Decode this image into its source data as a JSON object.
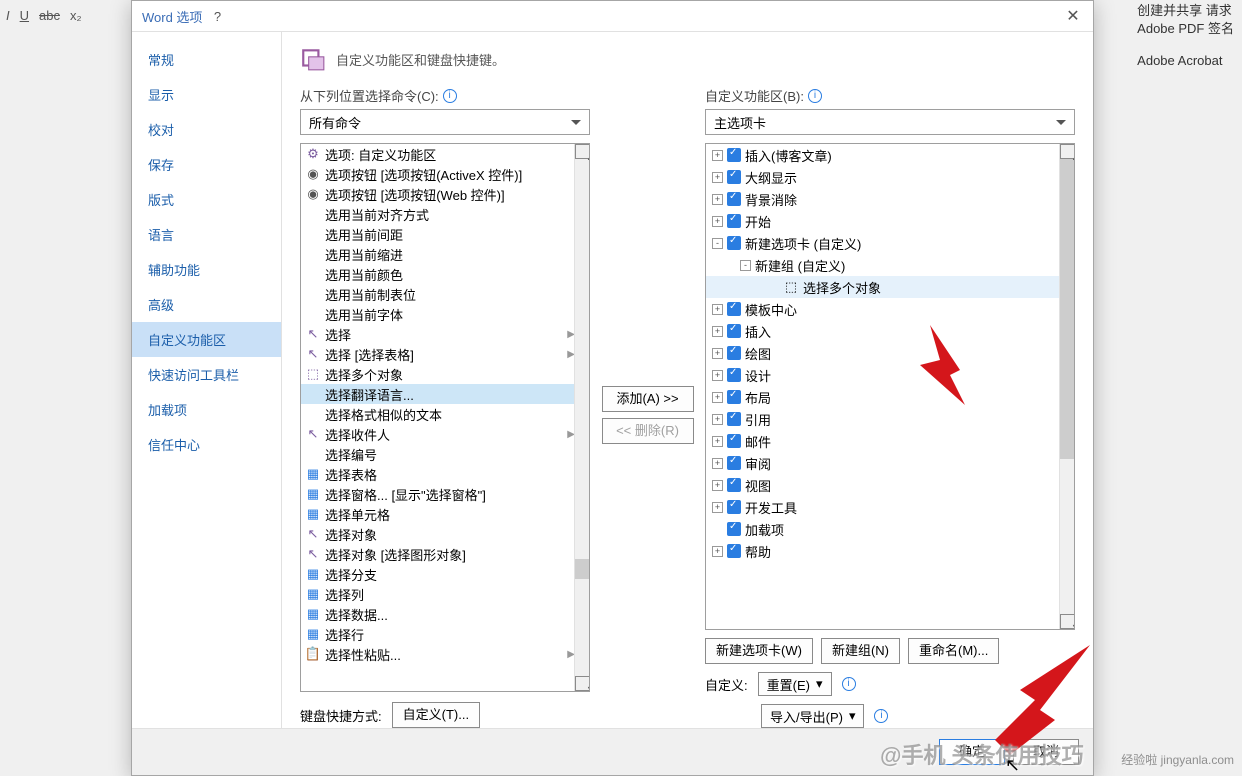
{
  "bg": {
    "right_line1": "创建并共享   请求",
    "right_line2": "Adobe PDF   签名",
    "right_line3": "Adobe Acrobat"
  },
  "dialog": {
    "title": "Word 选项",
    "heading": "自定义功能区和键盘快捷键。",
    "left_label": "从下列位置选择命令(C):",
    "left_dropdown": "所有命令",
    "right_label": "自定义功能区(B):",
    "right_dropdown": "主选项卡",
    "add_btn": "添加(A) >>",
    "remove_btn": "<< 删除(R)",
    "new_tab_btn": "新建选项卡(W)",
    "new_group_btn": "新建组(N)",
    "rename_btn": "重命名(M)...",
    "custom_label": "自定义:",
    "reset_btn": "重置(E)",
    "import_btn": "导入/导出(P)",
    "keyboard_label": "键盘快捷方式:",
    "keyboard_btn": "自定义(T)...",
    "ok": "确定",
    "cancel": "取消"
  },
  "side_nav": [
    "常规",
    "显示",
    "校对",
    "保存",
    "版式",
    "语言",
    "辅助功能",
    "高级",
    "自定义功能区",
    "快速访问工具栏",
    "加载项",
    "信任中心"
  ],
  "side_nav_active": 8,
  "command_list": [
    {
      "label": "选项: 自定义功能区",
      "icon": "option"
    },
    {
      "label": "选项按钮 [选项按钮(ActiveX 控件)]",
      "icon": "radio"
    },
    {
      "label": "选项按钮 [选项按钮(Web 控件)]",
      "icon": "radio"
    },
    {
      "label": "选用当前对齐方式",
      "icon": ""
    },
    {
      "label": "选用当前间距",
      "icon": ""
    },
    {
      "label": "选用当前缩进",
      "icon": ""
    },
    {
      "label": "选用当前颜色",
      "icon": ""
    },
    {
      "label": "选用当前制表位",
      "icon": ""
    },
    {
      "label": "选用当前字体",
      "icon": ""
    },
    {
      "label": "选择",
      "icon": "cursor",
      "arrow": true
    },
    {
      "label": "选择 [选择表格]",
      "icon": "cursor",
      "arrow": true
    },
    {
      "label": "选择多个对象",
      "icon": "cursor-multi"
    },
    {
      "label": "选择翻译语言...",
      "icon": "",
      "selected": true
    },
    {
      "label": "选择格式相似的文本",
      "icon": ""
    },
    {
      "label": "选择收件人",
      "icon": "cursor",
      "arrow": true
    },
    {
      "label": "选择编号",
      "icon": ""
    },
    {
      "label": "选择表格",
      "icon": "table"
    },
    {
      "label": "选择窗格... [显示\"选择窗格\"]",
      "icon": "table"
    },
    {
      "label": "选择单元格",
      "icon": "table"
    },
    {
      "label": "选择对象",
      "icon": "cursor"
    },
    {
      "label": "选择对象 [选择图形对象]",
      "icon": "cursor"
    },
    {
      "label": "选择分支",
      "icon": "table"
    },
    {
      "label": "选择列",
      "icon": "table"
    },
    {
      "label": "选择数据...",
      "icon": "table"
    },
    {
      "label": "选择行",
      "icon": "table"
    },
    {
      "label": "选择性粘贴...",
      "icon": "paste",
      "arrow": true
    }
  ],
  "tree": [
    {
      "label": "插入(博客文章)",
      "depth": 0,
      "check": true,
      "exp": "+"
    },
    {
      "label": "大纲显示",
      "depth": 0,
      "check": true,
      "exp": "+"
    },
    {
      "label": "背景消除",
      "depth": 0,
      "check": true,
      "exp": "+"
    },
    {
      "label": "开始",
      "depth": 0,
      "check": true,
      "exp": "+"
    },
    {
      "label": "新建选项卡 (自定义)",
      "depth": 0,
      "check": true,
      "exp": "-"
    },
    {
      "label": "新建组 (自定义)",
      "depth": 1,
      "check": false,
      "exp": "-"
    },
    {
      "label": "选择多个对象",
      "depth": 2,
      "selected": true,
      "check": false,
      "icon": "cursor-multi"
    },
    {
      "label": "模板中心",
      "depth": 0,
      "check": true,
      "exp": "+"
    },
    {
      "label": "插入",
      "depth": 0,
      "check": true,
      "exp": "+"
    },
    {
      "label": "绘图",
      "depth": 0,
      "check": true,
      "exp": "+"
    },
    {
      "label": "设计",
      "depth": 0,
      "check": true,
      "exp": "+"
    },
    {
      "label": "布局",
      "depth": 0,
      "check": true,
      "exp": "+"
    },
    {
      "label": "引用",
      "depth": 0,
      "check": true,
      "exp": "+"
    },
    {
      "label": "邮件",
      "depth": 0,
      "check": true,
      "exp": "+"
    },
    {
      "label": "审阅",
      "depth": 0,
      "check": true,
      "exp": "+"
    },
    {
      "label": "视图",
      "depth": 0,
      "check": true,
      "exp": "+"
    },
    {
      "label": "开发工具",
      "depth": 0,
      "check": true,
      "exp": "+"
    },
    {
      "label": "加载项",
      "depth": 0,
      "check": true,
      "exp": ""
    },
    {
      "label": "帮助",
      "depth": 0,
      "check": true,
      "exp": "+"
    }
  ],
  "watermark": "@手机 头条使用技巧",
  "watermark_sub": "经验啦 jingyanla.com"
}
